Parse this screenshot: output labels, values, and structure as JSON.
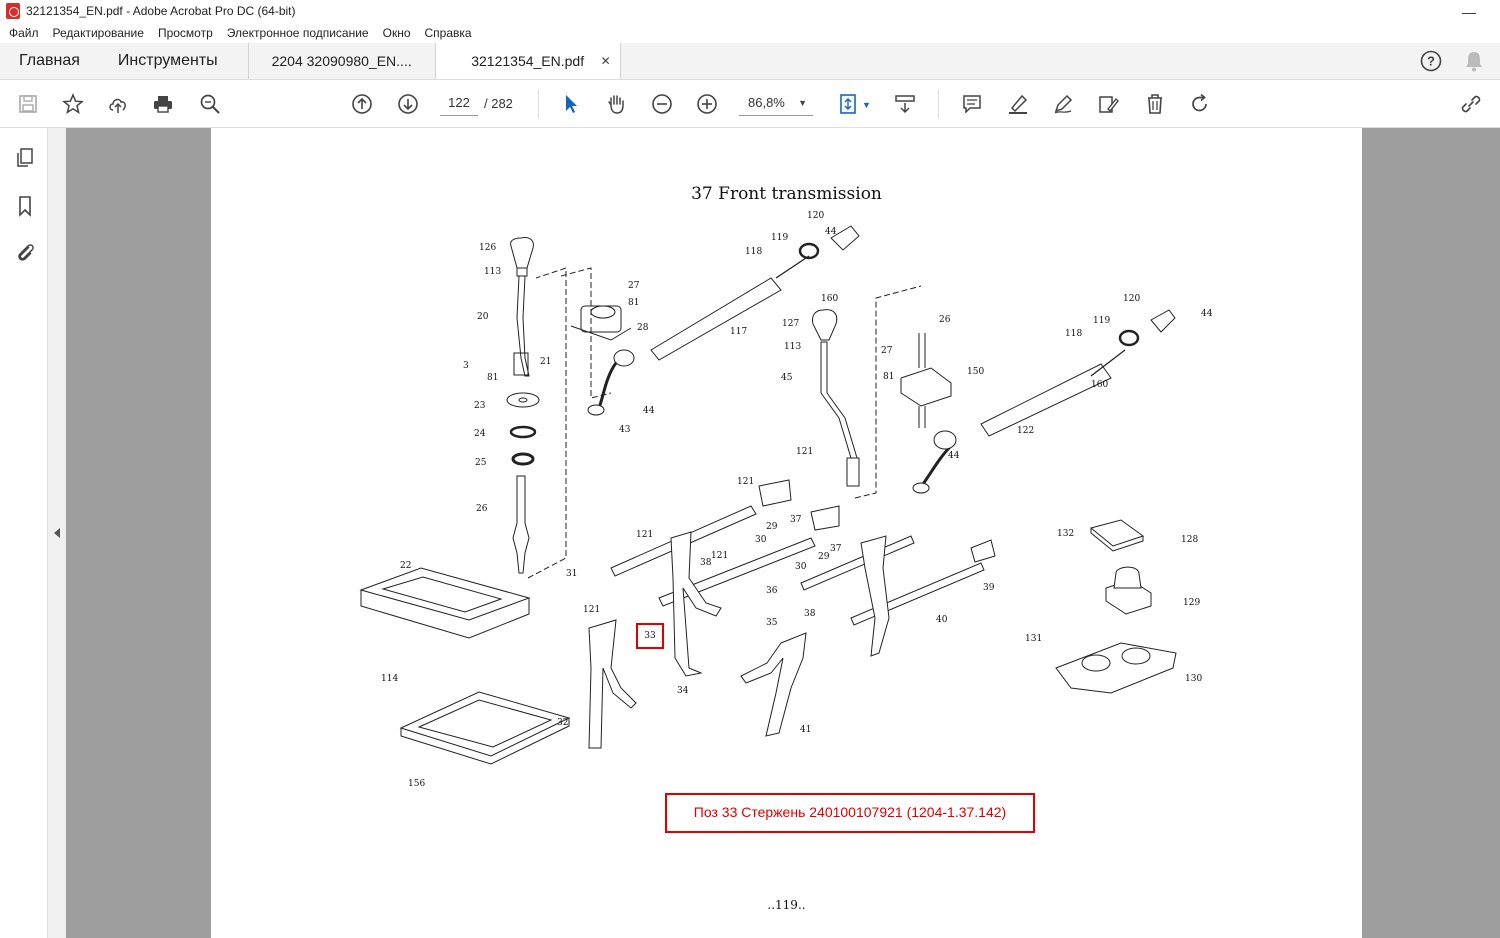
{
  "window": {
    "title": "32121354_EN.pdf - Adobe Acrobat Pro DC (64-bit)"
  },
  "menu": [
    "Файл",
    "Редактирование",
    "Просмотр",
    "Электронное подписание",
    "Окно",
    "Справка"
  ],
  "tabs": {
    "home": "Главная",
    "tools": "Инструменты",
    "doc1": "2204 32090980_EN....",
    "doc2": "32121354_EN.pdf"
  },
  "nav": {
    "page_current": "122",
    "page_total": "/ 282"
  },
  "zoom": {
    "value": "86,8%"
  },
  "pdf": {
    "title": "37 Front transmission",
    "footer": "..119..",
    "annotation": "Поз 33 Стержень 240100107921 (1204-1.37.142)",
    "callout": "33",
    "part_labels": [
      "126",
      "113",
      "20",
      "3",
      "81",
      "21",
      "23",
      "24",
      "25",
      "26",
      "22",
      "114",
      "156",
      "27",
      "81",
      "28",
      "117",
      "118",
      "119",
      "120",
      "44",
      "160",
      "43",
      "44",
      "127",
      "113",
      "45",
      "26",
      "27",
      "81",
      "150",
      "120",
      "119",
      "118",
      "44",
      "160",
      "122",
      "44",
      "121",
      "37",
      "121",
      "37",
      "29",
      "30",
      "38",
      "31",
      "121",
      "29",
      "30",
      "36",
      "38",
      "121",
      "35",
      "39",
      "40",
      "121",
      "32",
      "34",
      "41",
      "132",
      "128",
      "129",
      "131",
      "130"
    ]
  },
  "colors": {
    "accent": "#e10000",
    "viewport_bg": "#9e9e9e"
  }
}
